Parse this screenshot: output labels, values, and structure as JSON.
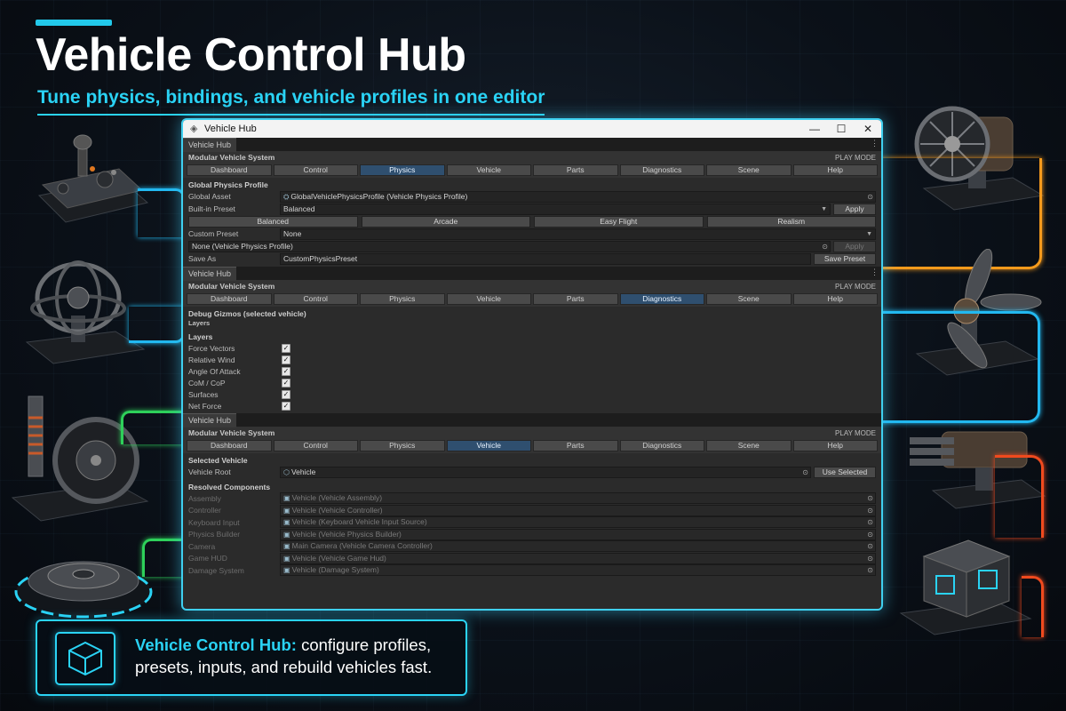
{
  "hero": {
    "title": "Vehicle Control Hub",
    "subtitle": "Tune physics, bindings, and vehicle profiles in one editor"
  },
  "window": {
    "title": "Vehicle Hub",
    "controls": {
      "minimize": "—",
      "maximize": "☐",
      "close": "✕"
    }
  },
  "nav_tabs": [
    "Dashboard",
    "Control",
    "Physics",
    "Vehicle",
    "Parts",
    "Diagnostics",
    "Scene",
    "Help"
  ],
  "panel1": {
    "tab": "Vehicle Hub",
    "system": "Modular Vehicle System",
    "mode": "PLAY MODE",
    "active_tab": "Physics",
    "section_title": "Global Physics Profile",
    "global_asset_label": "Global Asset",
    "global_asset_value": "GlobalVehiclePhysicsProfile (Vehicle Physics Profile)",
    "builtin_label": "Built-in Preset",
    "builtin_value": "Balanced",
    "apply_label": "Apply",
    "presets": [
      "Balanced",
      "Arcade",
      "Easy Flight",
      "Realism"
    ],
    "custom_label": "Custom Preset",
    "custom_value": "None",
    "none_profile_value": "None (Vehicle Physics Profile)",
    "apply_disabled_label": "Apply",
    "save_as_label": "Save As",
    "save_as_value": "CustomPhysicsPreset",
    "save_preset_label": "Save Preset"
  },
  "panel2": {
    "tab": "Vehicle Hub",
    "system": "Modular Vehicle System",
    "mode": "PLAY MODE",
    "active_tab": "Diagnostics",
    "section_title": "Debug Gizmos (selected vehicle)",
    "sub_title": "Layers",
    "layers_title": "Layers",
    "layers": [
      {
        "label": "Force Vectors",
        "checked": true
      },
      {
        "label": "Relative Wind",
        "checked": true
      },
      {
        "label": "Angle Of Attack",
        "checked": true
      },
      {
        "label": "CoM / CoP",
        "checked": true
      },
      {
        "label": "Surfaces",
        "checked": true
      },
      {
        "label": "Net Force",
        "checked": true
      }
    ]
  },
  "panel3": {
    "tab": "Vehicle Hub",
    "system": "Modular Vehicle System",
    "mode": "PLAY MODE",
    "active_tab": "Vehicle",
    "selected_title": "Selected Vehicle",
    "root_label": "Vehicle Root",
    "root_value": "Vehicle",
    "use_selected_label": "Use Selected",
    "resolved_title": "Resolved Components",
    "components": [
      {
        "label": "Assembly",
        "value": "Vehicle (Vehicle Assembly)"
      },
      {
        "label": "Controller",
        "value": "Vehicle (Vehicle Controller)"
      },
      {
        "label": "Keyboard Input",
        "value": "Vehicle (Keyboard Vehicle Input Source)"
      },
      {
        "label": "Physics Builder",
        "value": "Vehicle (Vehicle Physics Builder)"
      },
      {
        "label": "Camera",
        "value": "Main Camera (Vehicle Camera Controller)"
      },
      {
        "label": "Game HUD",
        "value": "Vehicle (Vehicle Game Hud)"
      },
      {
        "label": "Damage System",
        "value": "Vehicle (Damage System)"
      }
    ]
  },
  "callout": {
    "strong": "Vehicle Control Hub:",
    "text": " configure profiles, presets, inputs, and rebuild vehicles fast."
  },
  "colors": {
    "accent": "#2ad3f5",
    "active_tab": "#2f4f6f",
    "wire_blue": "#22b8f0",
    "wire_green": "#2ed05a",
    "wire_orange": "#f59a1c",
    "wire_red": "#f04a1e"
  },
  "icons": [
    "joystick-icon",
    "gyroscope-icon",
    "wheel-suspension-icon",
    "turntable-icon",
    "turbine-icon",
    "propeller-icon",
    "gatling-icon",
    "cube-module-icon",
    "cube-outline-icon"
  ]
}
